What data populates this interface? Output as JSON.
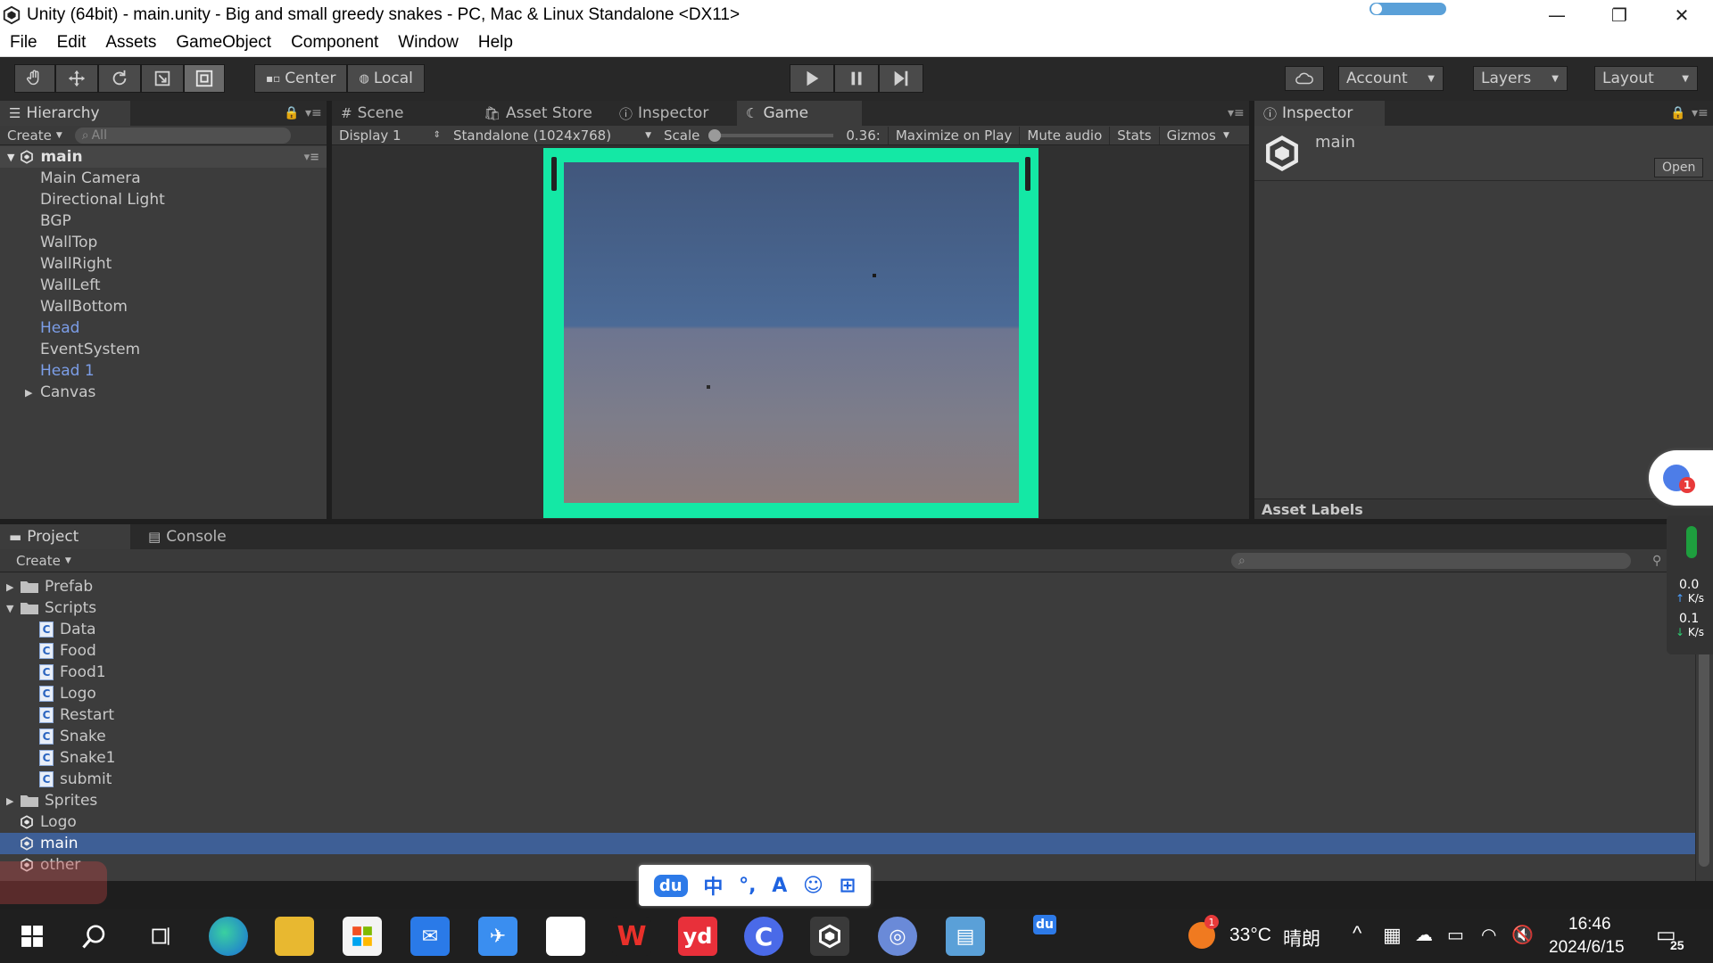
{
  "window": {
    "title": "Unity (64bit) - main.unity - Big and small greedy snakes - PC, Mac & Linux Standalone <DX11>",
    "minimize": "—",
    "maximize": "❐",
    "close": "✕"
  },
  "menubar": [
    "File",
    "Edit",
    "Assets",
    "GameObject",
    "Component",
    "Window",
    "Help"
  ],
  "toolbar": {
    "pivot": "Center",
    "space": "Local",
    "account": "Account",
    "layers": "Layers",
    "layout": "Layout"
  },
  "hierarchy": {
    "tab": "Hierarchy",
    "create": "Create",
    "search_placeholder": "All",
    "scene": "main",
    "items": [
      {
        "label": "Main Camera",
        "prefab": false
      },
      {
        "label": "Directional Light",
        "prefab": false
      },
      {
        "label": "BGP",
        "prefab": false
      },
      {
        "label": "WallTop",
        "prefab": false
      },
      {
        "label": "WallRight",
        "prefab": false
      },
      {
        "label": "WallLeft",
        "prefab": false
      },
      {
        "label": "WallBottom",
        "prefab": false
      },
      {
        "label": "Head",
        "prefab": true
      },
      {
        "label": "EventSystem",
        "prefab": false
      },
      {
        "label": "Head 1",
        "prefab": true
      },
      {
        "label": "Canvas",
        "prefab": false
      }
    ]
  },
  "center_tabs": {
    "scene": "Scene",
    "asset_store": "Asset Store",
    "inspector": "Inspector",
    "game": "Game"
  },
  "game_bar": {
    "display": "Display 1",
    "resolution": "Standalone (1024x768)",
    "scale_label": "Scale",
    "scale_value": "0.36:",
    "maximize": "Maximize on Play",
    "mute": "Mute audio",
    "stats": "Stats",
    "gizmos": "Gizmos"
  },
  "inspector": {
    "tab": "Inspector",
    "asset_name": "main",
    "open": "Open",
    "asset_labels": "Asset Labels"
  },
  "bottom_tabs": {
    "project": "Project",
    "console": "Console"
  },
  "project": {
    "create": "Create",
    "items": [
      {
        "label": "Prefab",
        "type": "folder",
        "indent": 0,
        "expanded": false
      },
      {
        "label": "Scripts",
        "type": "folder",
        "indent": 0,
        "expanded": true
      },
      {
        "label": "Data",
        "type": "script",
        "indent": 1
      },
      {
        "label": "Food",
        "type": "script",
        "indent": 1
      },
      {
        "label": "Food1",
        "type": "script",
        "indent": 1
      },
      {
        "label": "Logo",
        "type": "script",
        "indent": 1
      },
      {
        "label": "Restart",
        "type": "script",
        "indent": 1
      },
      {
        "label": "Snake",
        "type": "script",
        "indent": 1
      },
      {
        "label": "Snake1",
        "type": "script",
        "indent": 1
      },
      {
        "label": "submit",
        "type": "script",
        "indent": 1
      },
      {
        "label": "Sprites",
        "type": "folder",
        "indent": 0,
        "expanded": false
      },
      {
        "label": "Logo",
        "type": "scene",
        "indent": 0
      },
      {
        "label": "main",
        "type": "scene",
        "indent": 0,
        "selected": true
      },
      {
        "label": "other",
        "type": "scene",
        "indent": 0
      }
    ]
  },
  "network": {
    "up_value": "0.0",
    "up_unit": "K/s",
    "down_value": "0.1",
    "down_unit": "K/s"
  },
  "floating_badge": "1",
  "taskbar": {
    "weather_temp": "33°C",
    "weather_text": "晴朗",
    "time": "16:46",
    "date": "2024/6/15",
    "badge": "1",
    "du_label": "du",
    "notif_count": "25"
  },
  "ime": {
    "mode": "中",
    "punct": "°,"
  },
  "colors": {
    "game_border": "#14e8a5",
    "selected_row": "#3e5f96",
    "prefab_text": "#7c9ee8"
  }
}
